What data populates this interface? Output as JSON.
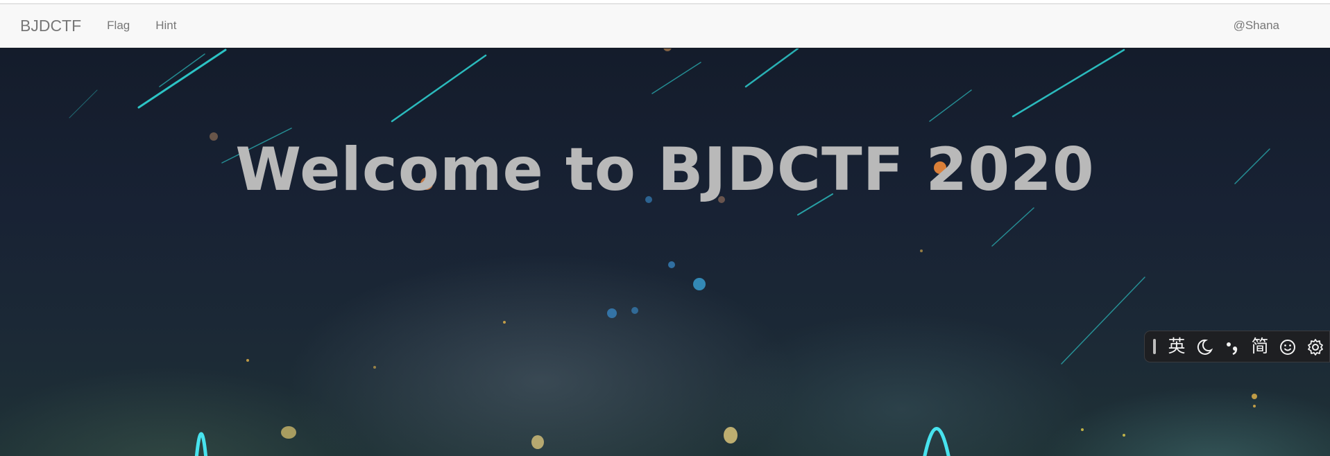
{
  "navbar": {
    "brand": "BJDCTF",
    "links": [
      "Flag",
      "Hint"
    ],
    "user": "@Shana"
  },
  "hero": {
    "title": "Welcome to BJDCTF 2020"
  },
  "ime_toolbar": {
    "lang": "英",
    "mode": "简",
    "items": [
      "moon-icon",
      "punctuation-icon",
      "emoji-icon",
      "gear-icon"
    ]
  },
  "colors": {
    "navbar_bg": "#f8f8f8",
    "nav_text": "#777777",
    "hero_bg": "#141c2b",
    "title_text": "#b9b9b9",
    "meteor": "#2fd6d6"
  }
}
